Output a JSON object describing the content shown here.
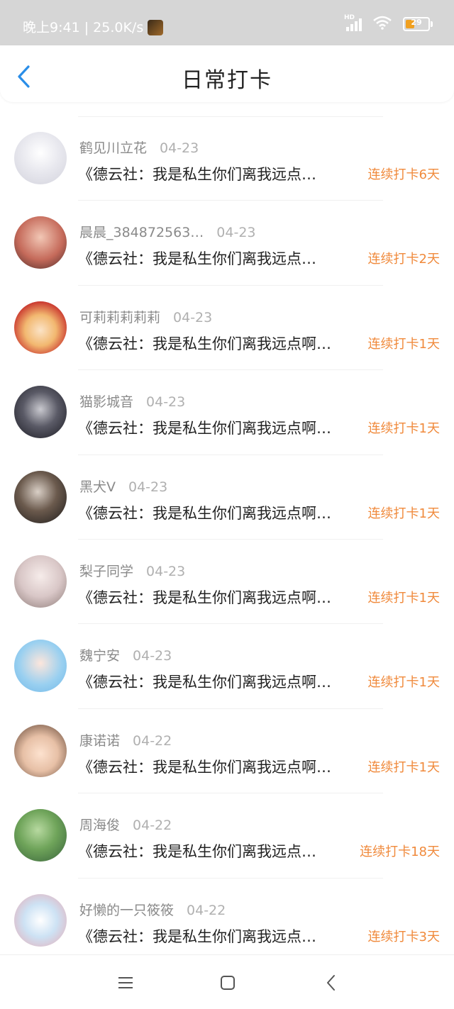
{
  "status_bar": {
    "time_speed": "晚上9:41 | 25.0K/s",
    "network_tag": "HD",
    "battery": "29"
  },
  "header": {
    "title": "日常打卡"
  },
  "colors": {
    "accent_blue": "#2a8ee8",
    "streak_orange": "#f08a3c"
  },
  "records": [
    {
      "name": "鹤见川立花",
      "date": "04-23",
      "content": "《德云社：我是私生你们离我远点…",
      "streak": "连续打卡6天",
      "avatar": "avatar-white-hair-girl"
    },
    {
      "name": "晨晨_384872563…",
      "date": "04-23",
      "content": "《德云社：我是私生你们离我远点…",
      "streak": "连续打卡2天",
      "avatar": "avatar-young-man"
    },
    {
      "name": "可莉莉莉莉莉",
      "date": "04-23",
      "content": "《德云社：我是私生你们离我远点啊…",
      "streak": "连续打卡1天",
      "avatar": "avatar-klee"
    },
    {
      "name": "猫影城音",
      "date": "04-23",
      "content": "《德云社：我是私生你们离我远点啊…",
      "streak": "连续打卡1天",
      "avatar": "avatar-dark-girl"
    },
    {
      "name": "黑犬V",
      "date": "04-23",
      "content": "《德云社：我是私生你们离我远点啊…",
      "streak": "连续打卡1天",
      "avatar": "avatar-violinist"
    },
    {
      "name": "梨子同学",
      "date": "04-23",
      "content": "《德云社：我是私生你们离我远点啊…",
      "streak": "连续打卡1天",
      "avatar": "avatar-girl-hat"
    },
    {
      "name": "魏宁安",
      "date": "04-23",
      "content": "《德云社：我是私生你们离我远点啊…",
      "streak": "连续打卡1天",
      "avatar": "avatar-anime-girl"
    },
    {
      "name": "康诺诺",
      "date": "04-22",
      "content": "《德云社：我是私生你们离我远点啊…",
      "streak": "连续打卡1天",
      "avatar": "avatar-cartoon-family"
    },
    {
      "name": "周海俊",
      "date": "04-22",
      "content": "《德云社：我是私生你们离我远点…",
      "streak": "连续打卡18天",
      "avatar": "avatar-flowers"
    },
    {
      "name": "好懒的一只筱筱",
      "date": "04-22",
      "content": "《德云社：我是私生你们离我远点…",
      "streak": "连续打卡3天",
      "avatar": "avatar-couple-drawing"
    }
  ],
  "nav_bar": {
    "icons": [
      "menu-icon",
      "home-icon",
      "back-icon"
    ]
  }
}
